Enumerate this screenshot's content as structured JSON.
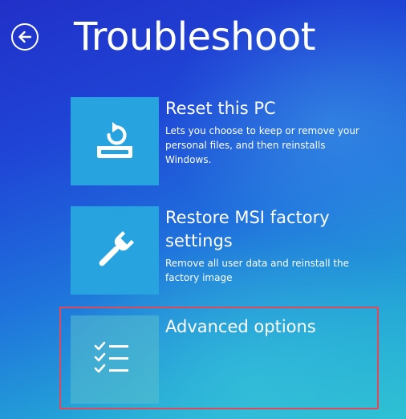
{
  "header": {
    "title": "Troubleshoot"
  },
  "options": [
    {
      "icon": "reset-pc-icon",
      "title": "Reset this PC",
      "description": "Lets you choose to keep or remove your personal files, and then reinstalls Windows."
    },
    {
      "icon": "wrench-icon",
      "title": "Restore MSI factory settings",
      "description": "Remove all user data and reinstall the factory image"
    },
    {
      "icon": "checklist-icon",
      "title": "Advanced options",
      "description": ""
    }
  ],
  "colors": {
    "tile": "#27a4df",
    "highlight": "#e04a58",
    "text": "#ffffff"
  }
}
